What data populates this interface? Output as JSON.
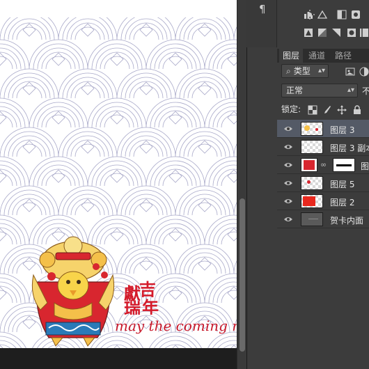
{
  "canvas": {
    "greeting_text": "may the coming n",
    "seal_chars": [
      "吉",
      "獻",
      "瑞",
      "年"
    ],
    "pattern_color": "#a9a9c9",
    "accent_red": "#c8182a"
  },
  "toolstrip": {
    "paragraph_icon": "¶"
  },
  "adjustments": {
    "icons": [
      "brightness-contrast-icon",
      "levels-icon",
      "curves-icon",
      "exposure-icon",
      "vibrance-icon",
      "hue-saturation-icon",
      "color-balance-icon",
      "black-white-icon",
      "photo-filter-icon",
      "channel-mixer-icon",
      "color-lookup-icon",
      "invert-icon",
      "posterize-icon",
      "threshold-icon",
      "gradient-map-icon"
    ]
  },
  "layers_panel": {
    "tabs": [
      {
        "label": "图层",
        "active": true
      },
      {
        "label": "通道",
        "active": false
      },
      {
        "label": "路径",
        "active": false
      }
    ],
    "filter_kind": "类型",
    "blend_mode": "正常",
    "opacity_label": "不",
    "lock_label": "锁定:",
    "layers": [
      {
        "name": "图层 3",
        "selected": true,
        "thumb": "transparent-mascot"
      },
      {
        "name": "图层 3 副本",
        "selected": false,
        "thumb": "transparent"
      },
      {
        "name": "图",
        "selected": false,
        "thumb": "red-with-mask"
      },
      {
        "name": "图层 5",
        "selected": false,
        "thumb": "transparent-red-dot"
      },
      {
        "name": "图层 2",
        "selected": false,
        "thumb": "red-block"
      },
      {
        "name": "贺卡内面",
        "selected": false,
        "thumb": "gray"
      }
    ]
  }
}
